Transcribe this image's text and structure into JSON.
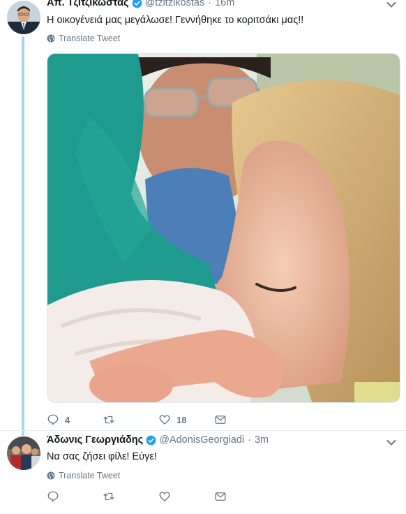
{
  "tweets": [
    {
      "author": {
        "name": "Απ. Τζιτζικώστας",
        "handle": "@tzitzikostas",
        "verified": true,
        "avatar": "avatar-man-suit"
      },
      "time": "16m",
      "separator": "·",
      "text": "Η οικογένειά μας μεγάλωσε! Γεννήθηκε το κοριτσάκι μας!!",
      "translate_label": "Translate Tweet",
      "media": {
        "type": "photo",
        "description_icon": "photo"
      },
      "actions": {
        "reply_count": "4",
        "retweet_count": "",
        "like_count": "18"
      }
    },
    {
      "author": {
        "name": "Άδωνις Γεωργιάδης",
        "handle": "@AdonisGeorgiadi",
        "verified": true,
        "avatar": "avatar-group"
      },
      "time": "3m",
      "separator": "·",
      "text": "Να σας ζήσει φίλε! Εύγε!",
      "translate_label": "Translate Tweet",
      "actions": {
        "reply_count": "",
        "retweet_count": "",
        "like_count": ""
      }
    }
  ],
  "colors": {
    "text": "#14171a",
    "muted": "#657786",
    "verified": "#1da1f2",
    "thread": "#a6d7ec",
    "border": "#e6ecf0"
  }
}
